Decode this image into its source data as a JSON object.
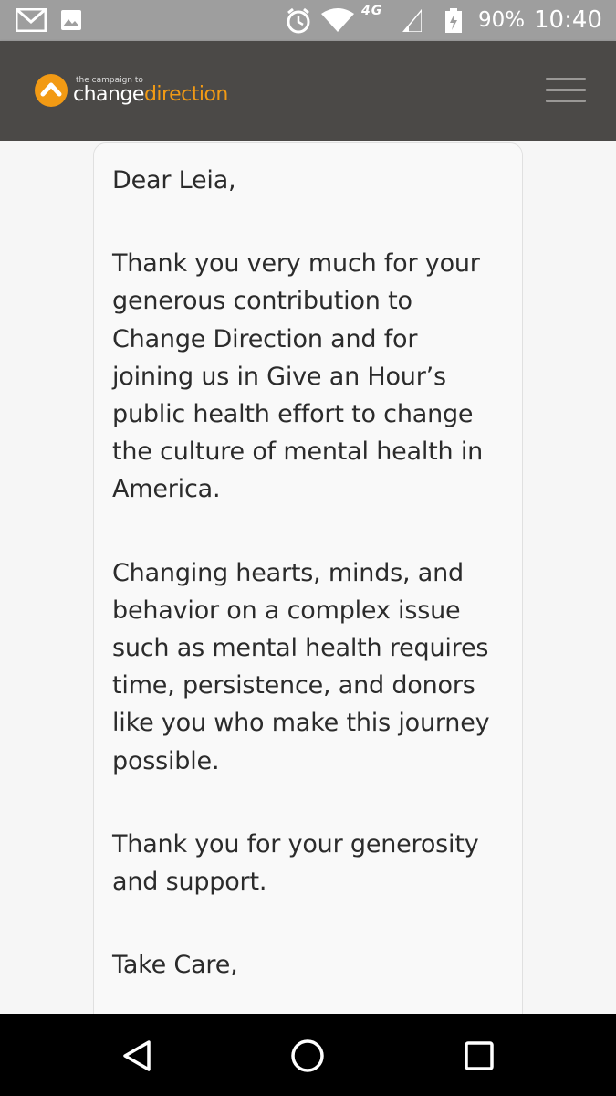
{
  "status_bar": {
    "network": "4G",
    "battery_percent": "90%",
    "time": "10:40",
    "icons": [
      "gmail-icon",
      "photo-icon",
      "alarm-icon",
      "wifi-icon",
      "signal-icon",
      "battery-icon"
    ]
  },
  "header": {
    "logo_tagline": "the campaign to",
    "logo_word1": "change",
    "logo_word2": "direction",
    "logo_reg": ".",
    "brand_color": "#f29a14",
    "header_color": "#4b4947"
  },
  "letter": {
    "greeting": "Dear Leia,",
    "paragraphs": [
      "Thank you very much for your generous contribution to Change Direction and for joining us in Give an Hour’s public health effort to change the culture of mental health in America.",
      "Changing hearts, minds, and behavior on a complex issue such as mental health requires time, persistence, and donors like you who make this journey possible.",
      "Thank you for your generosity and support."
    ],
    "closing": "Take Care,"
  },
  "nav_bar": {
    "buttons": [
      "back-icon",
      "home-icon",
      "recent-apps-icon"
    ]
  }
}
